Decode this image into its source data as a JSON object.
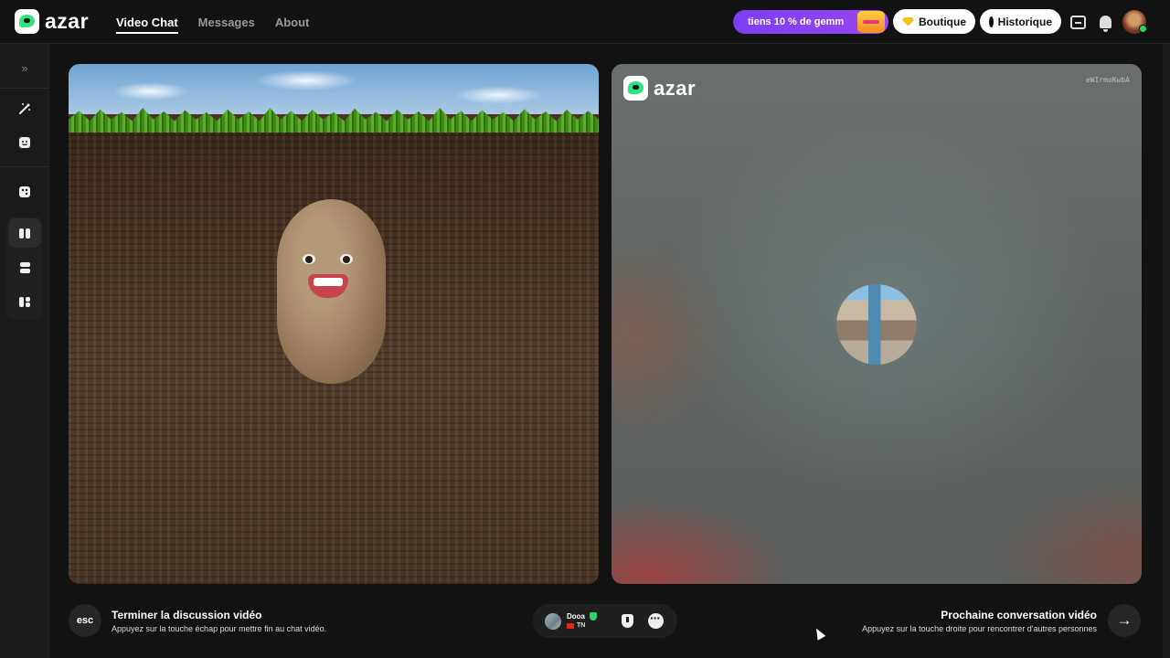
{
  "app": {
    "logo_text": "azar"
  },
  "nav": {
    "items": [
      {
        "label": "Video Chat",
        "active": true
      },
      {
        "label": "Messages",
        "active": false
      },
      {
        "label": "About",
        "active": false
      }
    ]
  },
  "header": {
    "promo_text": "tiens 10 % de gemm",
    "boutique_label": "Boutique",
    "historique_label": "Historique"
  },
  "sidebar": {
    "icons": [
      "expand-chevrons-icon",
      "magic-wand-icon",
      "face-sticker-icon",
      "dice-icon",
      "layout-side-by-side-icon",
      "layout-stacked-icon",
      "layout-grid-icon"
    ]
  },
  "remote_video": {
    "watermark_logo": "azar",
    "watermark_id": "eWIrmoKwbA"
  },
  "controls": {
    "esc_key": "esc",
    "end_title": "Terminer la discussion vidéo",
    "end_subtitle": "Appuyez sur la touche échap pour mettre fin au chat vidéo.",
    "next_title": "Prochaine conversation vidéo",
    "next_subtitle": "Appuyez sur la touche droite pour rencontrer d'autres personnes",
    "next_arrow": "→"
  },
  "partner": {
    "name": "Dooa",
    "country": "TN"
  },
  "colors": {
    "brand_green": "#2be57f",
    "promo_purple": "#8a42f1",
    "background": "#121212"
  }
}
